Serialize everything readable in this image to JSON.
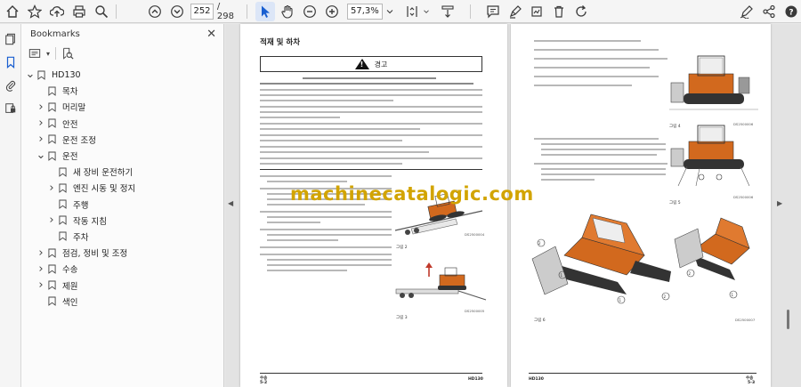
{
  "toolbar": {
    "current_page": "252",
    "total_pages": "/ 298",
    "zoom": "57,3%"
  },
  "bookmarks": {
    "title": "Bookmarks",
    "items": [
      {
        "label": "HD130",
        "level": 0,
        "chevron": "down"
      },
      {
        "label": "목차",
        "level": 1,
        "chevron": ""
      },
      {
        "label": "머리말",
        "level": 1,
        "chevron": "right"
      },
      {
        "label": "안전",
        "level": 1,
        "chevron": "right"
      },
      {
        "label": "운전 조정",
        "level": 1,
        "chevron": "right"
      },
      {
        "label": "운전",
        "level": 1,
        "chevron": "down"
      },
      {
        "label": "새 장비 운전하기",
        "level": 2,
        "chevron": ""
      },
      {
        "label": "엔진 시동 및 정지",
        "level": 2,
        "chevron": "right"
      },
      {
        "label": "주행",
        "level": 2,
        "chevron": ""
      },
      {
        "label": "작동 지침",
        "level": 2,
        "chevron": "right"
      },
      {
        "label": "주차",
        "level": 2,
        "chevron": ""
      },
      {
        "label": "점검, 정비 및 조정",
        "level": 1,
        "chevron": "right"
      },
      {
        "label": "수송",
        "level": 1,
        "chevron": "right"
      },
      {
        "label": "제원",
        "level": 1,
        "chevron": "right"
      },
      {
        "label": "색인",
        "level": 1,
        "chevron": ""
      }
    ]
  },
  "left_page": {
    "section_title": "적재 및 하차",
    "warning_label": "경고",
    "fig2_label": "그림 2",
    "fig2_code": "DS2500004",
    "fig3_label": "그림 3",
    "fig3_code": "DS2500005",
    "footer_left_top": "수송",
    "footer_left_bottom": "5-2",
    "footer_right": "HD130"
  },
  "right_page": {
    "fig4_label": "그림 4",
    "fig4_code": "DS2500006",
    "fig5_label": "그림 5",
    "fig5_code": "DS2500006",
    "fig6_label": "그림 6",
    "fig6_code": "DS2500007",
    "footer_left": "HD130",
    "footer_right_top": "수송",
    "footer_right_bottom": "5-3"
  },
  "watermark": "machinecatalogic.com",
  "colors": {
    "accent": "#1a5fd0",
    "machine_orange": "#d2691e",
    "watermark": "#d2a400"
  }
}
